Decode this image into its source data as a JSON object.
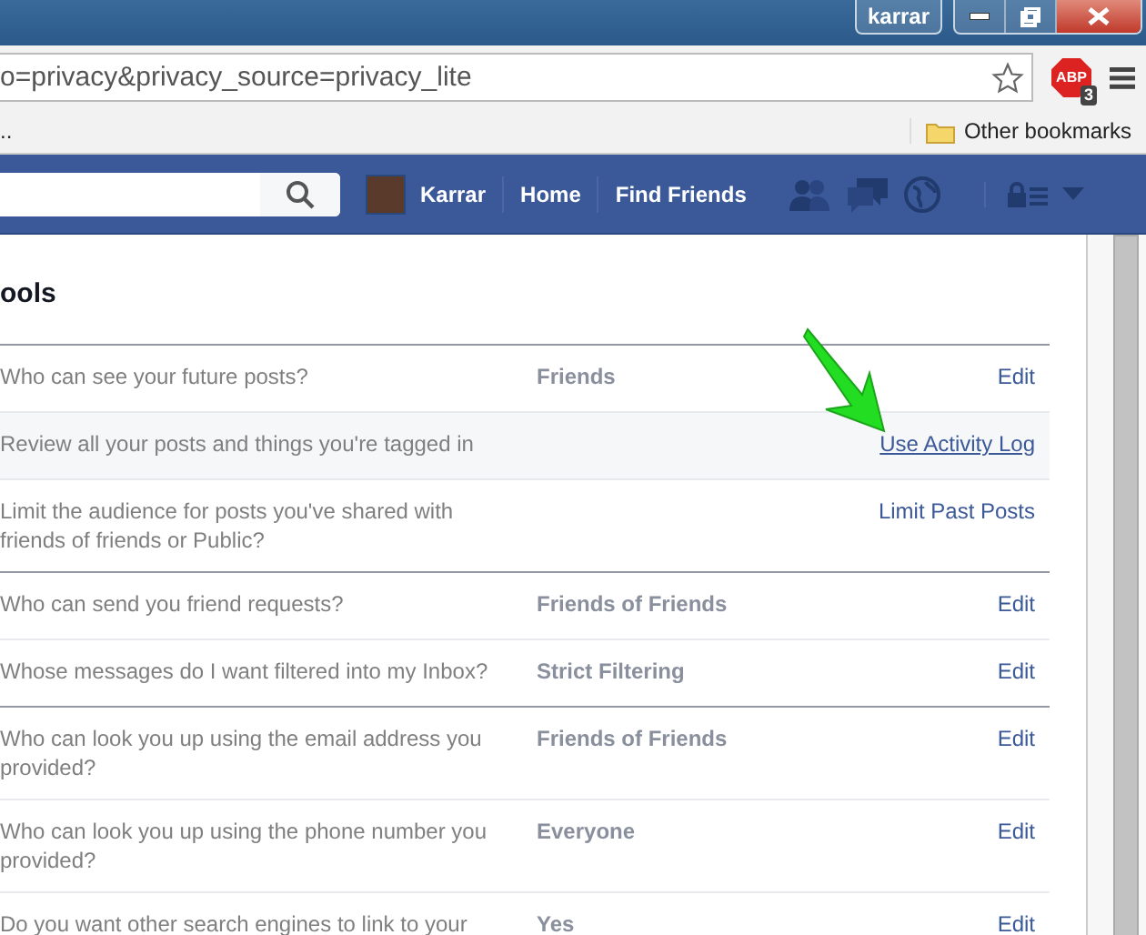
{
  "window": {
    "user": "karrar"
  },
  "address_bar": {
    "url": "o=privacy&privacy_source=privacy_lite",
    "extension_badge": "ABP",
    "extension_count": "3"
  },
  "bookmarks_bar": {
    "overflow": "..",
    "folder": "Other bookmarks"
  },
  "fb_bar": {
    "profile_name": "Karrar",
    "links": [
      "Home",
      "Find Friends"
    ]
  },
  "heading": "ools",
  "sections": [
    {
      "rows": [
        {
          "question": "Who can see your future posts?",
          "value": "Friends",
          "action": "Edit",
          "highlighted": false
        },
        {
          "question": "Review all your posts and things you're tagged in",
          "action": "Use Activity Log",
          "highlighted": true
        },
        {
          "question": "Limit the audience for posts you've shared with friends of friends or Public?",
          "action": "Limit Past Posts",
          "highlighted": false
        }
      ]
    },
    {
      "rows": [
        {
          "question": "Who can send you friend requests?",
          "value": "Friends of Friends",
          "action": "Edit",
          "highlighted": false
        },
        {
          "question": "Whose messages do I want filtered into my Inbox?",
          "value": "Strict Filtering",
          "action": "Edit",
          "highlighted": false
        }
      ]
    },
    {
      "rows": [
        {
          "question": "Who can look you up using the email address you provided?",
          "value": "Friends of Friends",
          "action": "Edit",
          "highlighted": false
        },
        {
          "question": "Who can look you up using the phone number you provided?",
          "value": "Everyone",
          "action": "Edit",
          "highlighted": false
        },
        {
          "question": "Do you want other search engines to link to your",
          "value": "Yes",
          "action": "Edit",
          "highlighted": false
        }
      ]
    }
  ]
}
